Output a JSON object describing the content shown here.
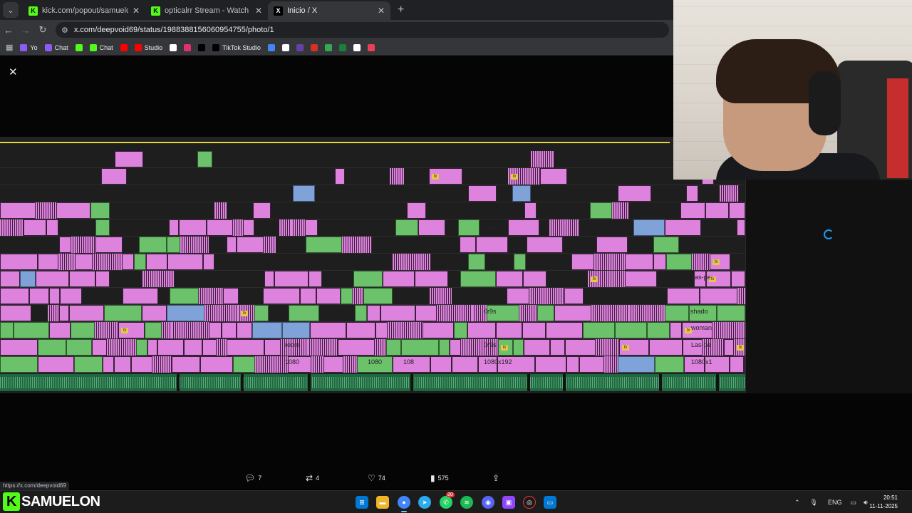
{
  "browser": {
    "tabs": [
      {
        "title": "kick.com/popout/samuelon/cha",
        "favicon": "kick-icon",
        "color": "#53fc18",
        "active": false
      },
      {
        "title": "opticalrr Stream - Watch Live o",
        "favicon": "kick-icon",
        "color": "#53fc18",
        "active": false
      },
      {
        "title": "Inicio / X",
        "favicon": "x-icon",
        "color": "#ffffff",
        "active": true
      }
    ],
    "new_tab": "+",
    "url": "x.com/deepvoid69/status/1988388156060954755/photo/1",
    "bookmarks": [
      {
        "label": "Yo",
        "color": "#8c5cf5"
      },
      {
        "label": "Chat",
        "color": "#8c5cf5"
      },
      {
        "label": "",
        "color": "#53fc18"
      },
      {
        "label": "Chat",
        "color": "#53fc18"
      },
      {
        "label": "",
        "color": "#ff0000"
      },
      {
        "label": "Studio",
        "color": "#ff0000"
      },
      {
        "label": "",
        "color": "#ffffff"
      },
      {
        "label": "",
        "color": "#e1306c"
      },
      {
        "label": "",
        "color": "#000000"
      },
      {
        "label": "TikTok Studio",
        "color": "#000000"
      },
      {
        "label": "",
        "color": "#4285f4"
      },
      {
        "label": "",
        "color": "#ffffff"
      },
      {
        "label": "",
        "color": "#6441a5"
      },
      {
        "label": "",
        "color": "#d93025"
      },
      {
        "label": "",
        "color": "#34a853"
      },
      {
        "label": "",
        "color": "#188038"
      },
      {
        "label": "",
        "color": "#ffffff"
      },
      {
        "label": "",
        "color": "#e94057"
      }
    ],
    "status_url": "https://x.com/deepvoid69"
  },
  "timeline": {
    "labels": [
      {
        "text": "Adju"
      },
      {
        "text": "Las-pe"
      },
      {
        "text": "0r9s"
      },
      {
        "text": "shado"
      },
      {
        "text": "woman"
      },
      {
        "text": "room"
      },
      {
        "text": "0r9s"
      },
      {
        "text": "Las-pe"
      },
      {
        "text": "1080"
      },
      {
        "text": "1080"
      },
      {
        "text": "108"
      },
      {
        "text": "1080x192"
      },
      {
        "text": "1080x1"
      }
    ]
  },
  "tweet": {
    "replies": "7",
    "reposts": "4",
    "likes": "74",
    "views": "575"
  },
  "taskbar": {
    "streamer_name": "SAMUELON",
    "language": "ENG",
    "time": "20:51",
    "date": "11-11-2025",
    "notification_badge": "20"
  }
}
